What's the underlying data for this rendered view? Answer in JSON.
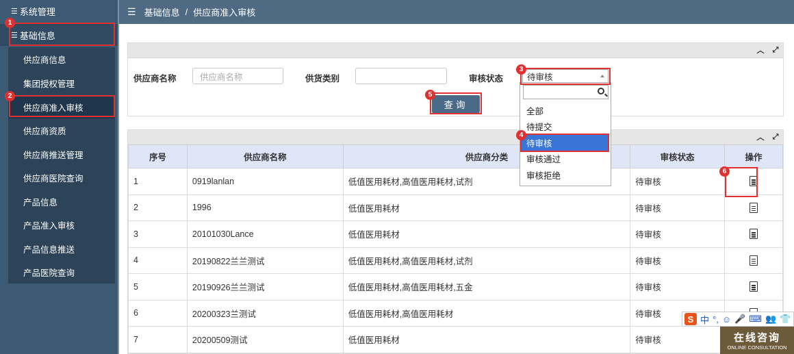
{
  "sidebar": {
    "system_mgmt": "系统管理",
    "base_info": "基础信息",
    "items": [
      {
        "label": "供应商信息"
      },
      {
        "label": "集团授权管理"
      },
      {
        "label": "供应商准入审核"
      },
      {
        "label": "供应商资质"
      },
      {
        "label": "供应商推送管理"
      },
      {
        "label": "供应商医院查询"
      },
      {
        "label": "产品信息"
      },
      {
        "label": "产品准入审核"
      },
      {
        "label": "产品信息推送"
      },
      {
        "label": "产品医院查询"
      }
    ]
  },
  "breadcrumb": {
    "root": "基础信息",
    "separator": "/",
    "current": "供应商准入审核"
  },
  "filters": {
    "supplier_name_label": "供应商名称",
    "supplier_name_placeholder": "供应商名称",
    "supply_type_label": "供货类别",
    "audit_status_label": "审核状态",
    "audit_status_value": "待审核",
    "query_button": "查询",
    "audit_status_options": [
      "全部",
      "待提交",
      "待审核",
      "审核通过",
      "审核拒绝"
    ]
  },
  "table": {
    "headers": [
      "序号",
      "供应商名称",
      "供应商分类",
      "审核状态",
      "操作"
    ],
    "rows": [
      {
        "no": "1",
        "name": "0919lanlan",
        "category": "低值医用耗材,高值医用耗材,试剂",
        "status": "待审核"
      },
      {
        "no": "2",
        "name": "1996",
        "category": "低值医用耗材",
        "status": "待审核"
      },
      {
        "no": "3",
        "name": "20101030Lance",
        "category": "低值医用耗材",
        "status": "待审核"
      },
      {
        "no": "4",
        "name": "20190822兰兰测试",
        "category": "低值医用耗材,高值医用耗材,试剂",
        "status": "待审核"
      },
      {
        "no": "5",
        "name": "20190926兰兰测试",
        "category": "低值医用耗材,高值医用耗材,五金",
        "status": "待审核"
      },
      {
        "no": "6",
        "name": "20200323兰测试",
        "category": "低值医用耗材,高值医用耗材",
        "status": "待审核"
      },
      {
        "no": "7",
        "name": "20200509测试",
        "category": "低值医用耗材",
        "status": "待审核"
      }
    ]
  },
  "annotations": [
    "1",
    "2",
    "3",
    "4",
    "5",
    "6"
  ],
  "ime": {
    "mode": "中",
    "punct": "°,"
  },
  "consult": {
    "title": "在线咨询",
    "subtitle": "ONLINE CONSULTATION"
  },
  "colors": {
    "sidebar": "#3d5a74",
    "topbar": "#4f6b84",
    "button": "#4a6a87",
    "highlight": "#3875d7",
    "marker": "#e03030"
  }
}
